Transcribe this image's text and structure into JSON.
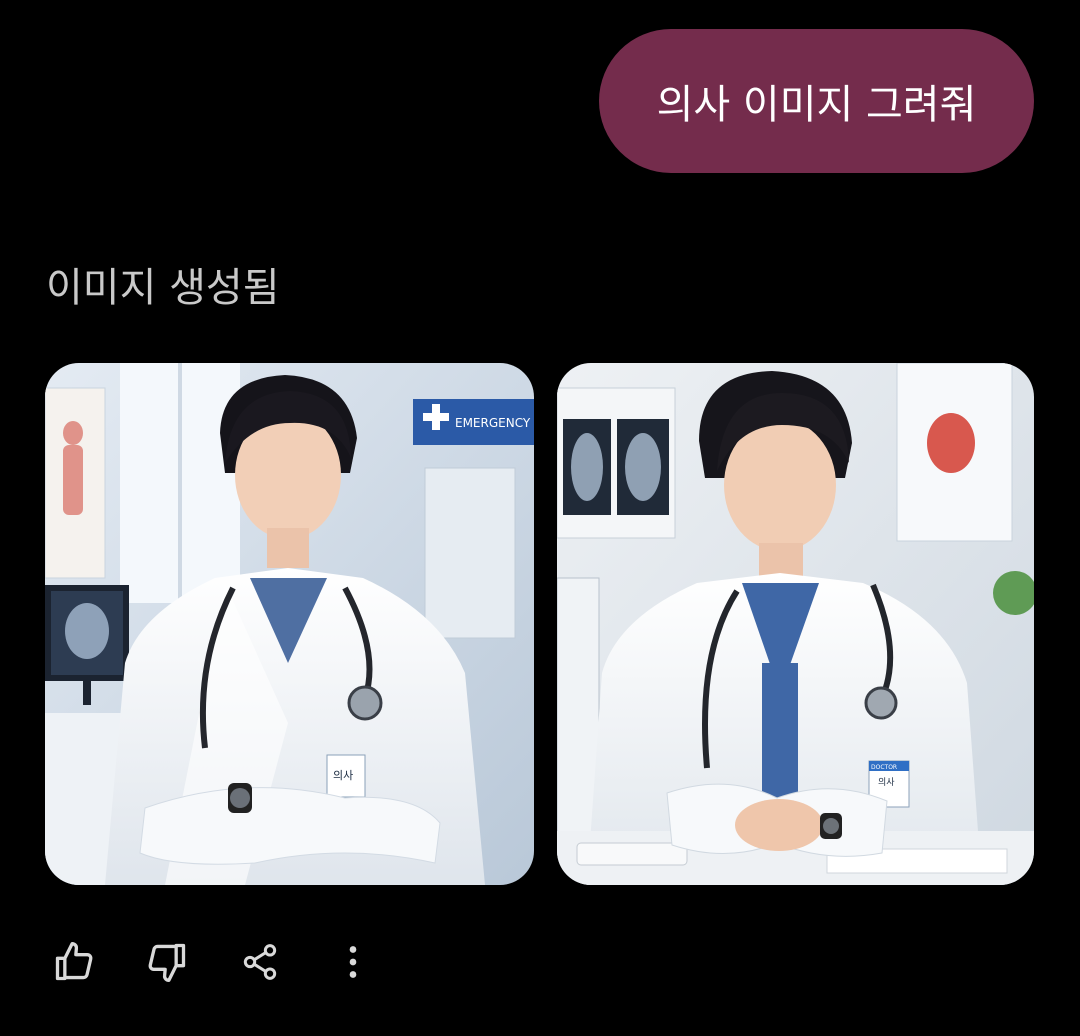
{
  "chat": {
    "user_message": "의사 이미지 그려줘",
    "status": "이미지 생성됨"
  },
  "images": [
    {
      "badge_text": "EMERGENCY",
      "id_text": "의사"
    },
    {
      "badge_text": "DOCTOR",
      "id_text": "의사"
    }
  ],
  "actions": [
    {
      "icon": "thumbs-up-icon"
    },
    {
      "icon": "thumbs-down-icon"
    },
    {
      "icon": "share-icon"
    },
    {
      "icon": "more-vertical-icon"
    }
  ],
  "colors": {
    "bubble": "#742c4c",
    "status_text": "#c9c9c9",
    "icon": "#d9d9d9",
    "background": "#000000"
  }
}
